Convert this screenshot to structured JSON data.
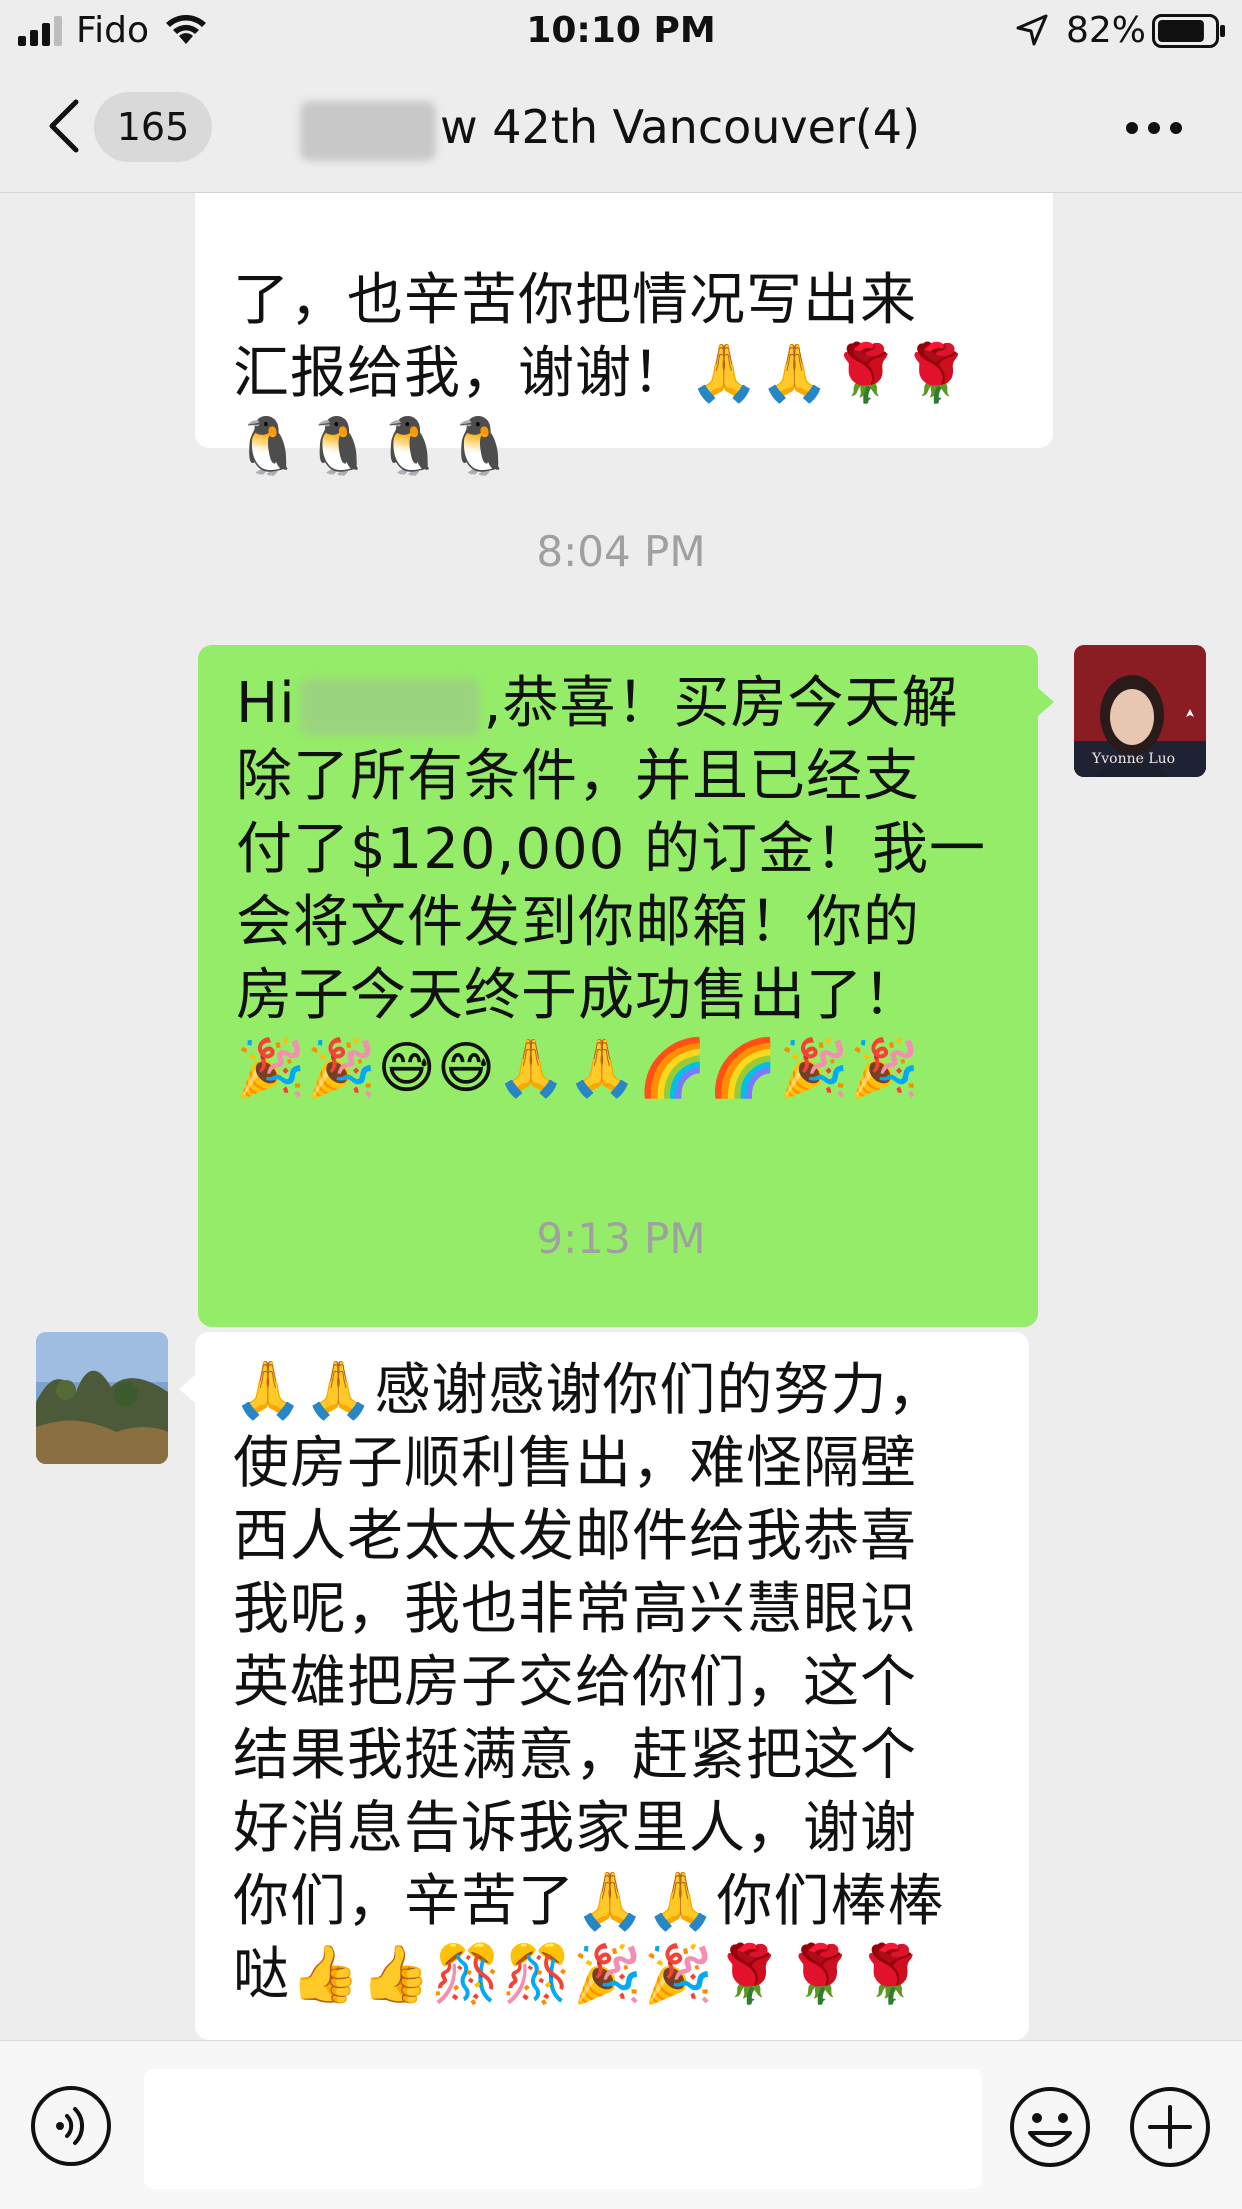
{
  "status_bar": {
    "carrier": "Fido",
    "time": "10:10 PM",
    "battery_percent": "82%",
    "battery_level": 0.82,
    "signal_bars": 3,
    "icons": [
      "signal-icon",
      "wifi-icon",
      "location-arrow-icon",
      "battery-icon"
    ]
  },
  "nav": {
    "unread_count": "165",
    "title": "w 42th Vancouver(4)",
    "icons": [
      "back-chevron-icon",
      "more-icon"
    ]
  },
  "messages": [
    {
      "from": "other",
      "lines": [
        "了，也辛苦你把情况写出来",
        "汇报给我，谢谢！🙏🙏🌹🌹",
        "🐧🐧🐧🐧"
      ]
    },
    {
      "timestamp": "8:04 PM"
    },
    {
      "from": "self",
      "greeting": "Hi",
      "first_line_rest": ",恭喜！买房今天解",
      "lines": [
        "除了所有条件，并且已经支",
        "付了$120,000 的订金！我一",
        "会将文件发到你邮箱！你的",
        "房子今天终于成功售出了！",
        "🎉🎉😅😅🙏🙏🌈🌈🎉🎉"
      ],
      "avatar_caption": "Yvonne Luo"
    },
    {
      "timestamp": "9:13 PM"
    },
    {
      "from": "other",
      "lines": [
        "🙏🙏感谢感谢你们的努力，",
        "使房子顺利售出，难怪隔壁",
        "西人老太太发邮件给我恭喜",
        "我呢，我也非常高兴慧眼识",
        "英雄把房子交给你们，这个",
        "结果我挺满意，赶紧把这个",
        "好消息告诉我家里人，谢谢",
        "你们，辛苦了🙏🙏你们棒棒",
        "哒👍👍🎊🎊🎉🎉🌹🌹🌹"
      ]
    }
  ],
  "input_bar": {
    "placeholder": "",
    "icons": [
      "voice-icon",
      "emoji-icon",
      "plus-icon"
    ]
  },
  "colors": {
    "background": "#ededed",
    "self_bubble": "#95ec69",
    "other_bubble": "#ffffff",
    "timestamp": "#a0a0a0"
  }
}
